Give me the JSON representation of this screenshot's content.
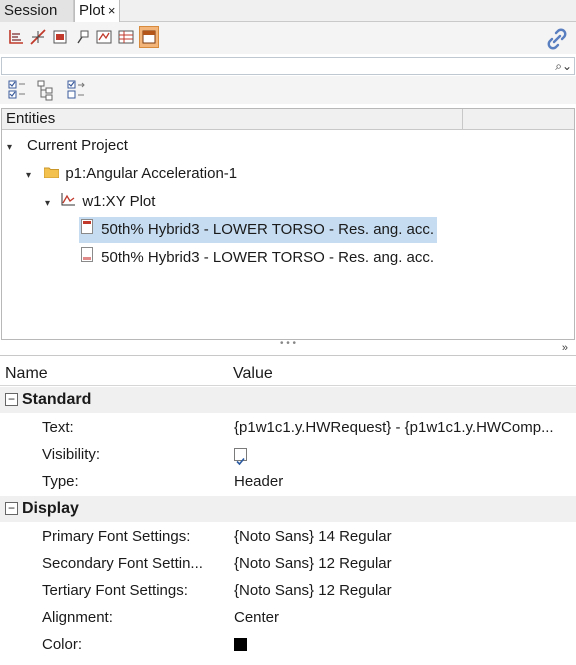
{
  "tabs": [
    {
      "label": "Session"
    },
    {
      "label": "Plot",
      "close": "×"
    }
  ],
  "search": {
    "placeholder": "",
    "value": ""
  },
  "entities": {
    "header": "Entities",
    "nodes": [
      {
        "label": "Current Project"
      },
      {
        "label": "p1:Angular Acceleration-1"
      },
      {
        "label": "w1:XY Plot"
      },
      {
        "label": "50th% Hybrid3   - LOWER TORSO - Res. ang. acc.",
        "selected": true
      },
      {
        "label": "50th% Hybrid3   - LOWER TORSO - Res. ang. acc.",
        "selected": false
      }
    ]
  },
  "splitter": "• • •",
  "properties": {
    "col_name": "Name",
    "col_value": "Value",
    "groups": [
      {
        "name": "Standard",
        "toggle": "−",
        "rows": [
          {
            "name": "Text:",
            "value": "{p1w1c1.y.HWRequest} - {p1w1c1.y.HWComp..."
          },
          {
            "name": "Visibility:",
            "value": "checked"
          },
          {
            "name": "Type:",
            "value": "Header"
          }
        ]
      },
      {
        "name": "Display",
        "toggle": "−",
        "rows": [
          {
            "name": "Primary Font Settings:",
            "value": "{Noto Sans} 14 Regular"
          },
          {
            "name": "Secondary Font Settin...",
            "value": "{Noto Sans} 12 Regular"
          },
          {
            "name": "Tertiary Font Settings:",
            "value": "{Noto Sans} 12 Regular"
          },
          {
            "name": "Alignment:",
            "value": "Center"
          },
          {
            "name": "Color:",
            "value": "#000000"
          }
        ]
      }
    ]
  },
  "colors": {
    "accent_active": "#f3b57a",
    "selection": "#c6dcf0",
    "link": "#5a7fc0"
  }
}
